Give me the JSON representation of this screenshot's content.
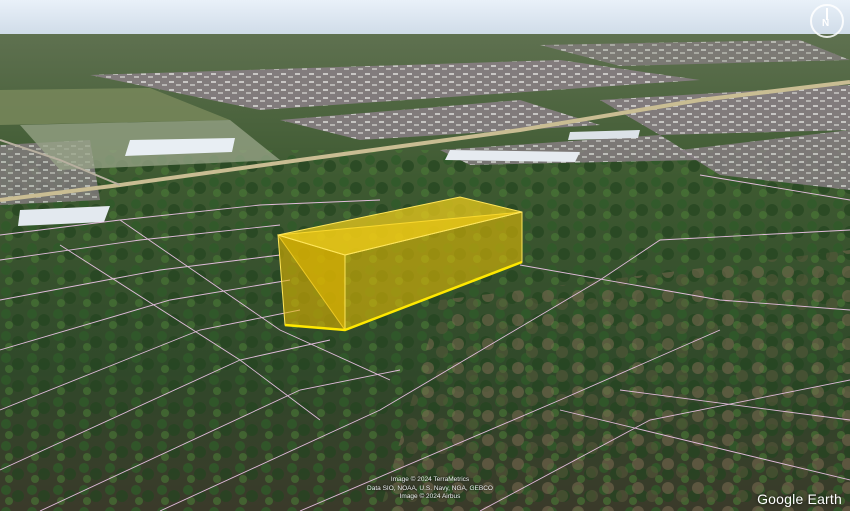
{
  "map": {
    "view": "3D satellite",
    "overlay_color": "#f2c400",
    "parcel_line_color": "#f3c8ee"
  },
  "compass": {
    "label": "N"
  },
  "credits": {
    "line1": "Image © 2024 TerraMetrics",
    "line2": "Data SIO, NOAA, U.S. Navy, NGA, GEBCO",
    "line3": "Image © 2024 Airbus"
  },
  "logo": {
    "text": "Google Earth"
  }
}
